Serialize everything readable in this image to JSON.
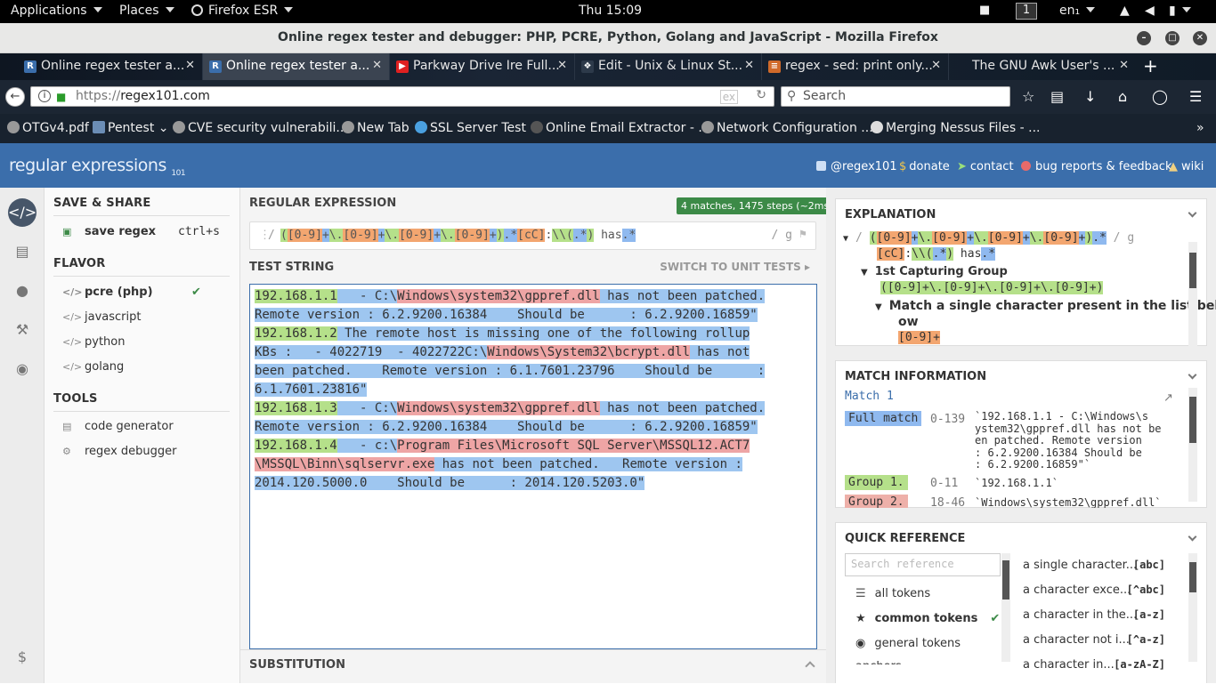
{
  "topbar": {
    "applications": "Applications",
    "places": "Places",
    "firefox": "Firefox ESR",
    "clock": "Thu 15:09",
    "workspace": "1",
    "lang": "en₁"
  },
  "window": {
    "title": "Online regex tester and debugger: PHP, PCRE, Python, Golang and JavaScript - Mozilla Firefox"
  },
  "tabs": [
    {
      "label": "Online regex tester a...",
      "icon": "R",
      "color": "#3b6eab"
    },
    {
      "label": "Online regex tester a...",
      "icon": "R",
      "color": "#3b6eab"
    },
    {
      "label": "Parkway Drive Ire Full...",
      "icon": "▶",
      "color": "#e02020"
    },
    {
      "label": "Edit - Unix & Linux St...",
      "icon": "❖",
      "color": "#2d3a4a"
    },
    {
      "label": "regex - sed: print only...",
      "icon": "≡",
      "color": "#d06a2a"
    },
    {
      "label": "The GNU Awk User's ...",
      "icon": "",
      "color": "#0e1621"
    }
  ],
  "nav": {
    "url_prefix": "https://",
    "url_host": "regex101.com",
    "search_placeholder": "Search"
  },
  "bookmarks": [
    "OTGv4.pdf",
    "Pentest",
    "CVE security vulnerabili...",
    "New Tab",
    "SSL Server Test",
    "Online Email Extractor - ...",
    "Network Configuration ...",
    "Merging Nessus Files - ..."
  ],
  "header": {
    "logo": "regular expressions",
    "logo_sub": "101",
    "links": [
      "@regex101",
      "donate",
      "contact",
      "bug reports & feedback",
      "wiki"
    ]
  },
  "left": {
    "save_share": "SAVE & SHARE",
    "save_regex": "save regex",
    "save_shortcut": "ctrl+s",
    "flavor": "FLAVOR",
    "flavors": [
      "pcre (php)",
      "javascript",
      "python",
      "golang"
    ],
    "tools": "TOOLS",
    "tool_items": [
      "code generator",
      "regex debugger"
    ]
  },
  "regex": {
    "section": "REGULAR EXPRESSION",
    "badge": "4 matches, 1475 steps (~2ms)",
    "delim": "/",
    "flags": "/ g",
    "parts": [
      {
        "t": "(",
        "c": "g1"
      },
      {
        "t": "[0-9]",
        "c": "o"
      },
      {
        "t": "+",
        "c": "b"
      },
      {
        "t": "\\.",
        "c": "g1"
      },
      {
        "t": "[0-9]",
        "c": "o"
      },
      {
        "t": "+",
        "c": "b"
      },
      {
        "t": "\\.",
        "c": "g1"
      },
      {
        "t": "[0-9]",
        "c": "o"
      },
      {
        "t": "+",
        "c": "b"
      },
      {
        "t": "\\.",
        "c": "g1"
      },
      {
        "t": "[0-9]",
        "c": "o"
      },
      {
        "t": "+",
        "c": "b"
      },
      {
        "t": ")",
        "c": "g1"
      },
      {
        "t": ".*",
        "c": "b"
      },
      {
        "t": "[cC]",
        "c": "o"
      },
      {
        "t": ":",
        "c": ""
      },
      {
        "t": "\\\\",
        "c": "g1"
      },
      {
        "t": "(",
        "c": "g1"
      },
      {
        "t": ".*",
        "c": "b"
      },
      {
        "t": ")",
        "c": "g1"
      },
      {
        "t": " has",
        "c": ""
      },
      {
        "t": ".*",
        "c": "b"
      }
    ]
  },
  "test": {
    "section": "TEST STRING",
    "switch": "SWITCH TO UNIT TESTS",
    "lines": [
      [
        {
          "t": "192.168.1.1",
          "c": "mt"
        },
        {
          "t": "   - C:\\",
          "c": "hl"
        },
        {
          "t": "Windows\\system32\\gppref.dll",
          "c": "pk"
        },
        {
          "t": " has not been patched.",
          "c": "hl"
        }
      ],
      [
        {
          "t": "Remote version : 6.2.9200.16384    Should be      : 6.2.9200.16859\"",
          "c": "hl"
        }
      ],
      [
        {
          "t": "192.168.1.2",
          "c": "mt"
        },
        {
          "t": " The remote host is missing one of the following rollup",
          "c": "hl"
        }
      ],
      [
        {
          "t": "KBs :   - 4022719  - 4022722C:\\",
          "c": "hl"
        },
        {
          "t": "Windows\\System32\\bcrypt.dll",
          "c": "pk"
        },
        {
          "t": " has not",
          "c": "hl"
        }
      ],
      [
        {
          "t": "been patched.    Remote version : 6.1.7601.23796    Should be      :",
          "c": "hl"
        }
      ],
      [
        {
          "t": "6.1.7601.23816\"",
          "c": "hl"
        }
      ],
      [
        {
          "t": "192.168.1.3",
          "c": "mt"
        },
        {
          "t": "   - C:\\",
          "c": "hl"
        },
        {
          "t": "Windows\\system32\\gppref.dll",
          "c": "pk"
        },
        {
          "t": " has not been patched.",
          "c": "hl"
        }
      ],
      [
        {
          "t": "Remote version : 6.2.9200.16384    Should be      : 6.2.9200.16859\"",
          "c": "hl"
        }
      ],
      [
        {
          "t": "192.168.1.4",
          "c": "mt"
        },
        {
          "t": "   - c:\\",
          "c": "hl"
        },
        {
          "t": "Program Files\\Microsoft SQL Server\\MSSQL12.ACT7",
          "c": "pk"
        }
      ],
      [
        {
          "t": "\\MSSQL\\Binn\\sqlservr.exe",
          "c": "pk"
        },
        {
          "t": " has not been patched.   Remote version :",
          "c": "hl"
        }
      ],
      [
        {
          "t": "2014.120.5000.0    Should be      : 2014.120.5203.0\"",
          "c": "hl"
        }
      ]
    ]
  },
  "substitution": "SUBSTITUTION",
  "explanation": {
    "title": "EXPLANATION",
    "row1_tail": " / g",
    "row2_b": "[cC]",
    "row2_c": ":",
    "row2_d": "\\\\(",
    "row2_e": ".*",
    "row2_f": ")",
    "row2_g": " has",
    "row2_h": ".*",
    "group1": "1st Capturing Group",
    "group1_expr": "([0-9]+\\.[0-9]+\\.[0-9]+\\.[0-9]+)",
    "match_single": "Match a single character present in the list bel",
    "match_single2": "ow",
    "range": "[0-9]+"
  },
  "match_info": {
    "title": "MATCH INFORMATION",
    "match_label": "Match 1",
    "full_label": "Full match",
    "full_range": "0-139",
    "full_value": [
      "`192.168.1.1   - C:\\Windows\\s",
      "ystem32\\gppref.dll has not be",
      "en patched.    Remote version",
      ": 6.2.9200.16384    Should be",
      ": 6.2.9200.16859\"`"
    ],
    "group1_label": "Group 1.",
    "group1_range": "0-11",
    "group1_value": "`192.168.1.1`",
    "group2_label": "Group 2.",
    "group2_range": "18-46",
    "group2_value": "`Windows\\system32\\gppref.dll`"
  },
  "quickref": {
    "title": "QUICK REFERENCE",
    "search_placeholder": "Search reference",
    "cats": [
      "all tokens",
      "common tokens",
      "general tokens",
      "anchors"
    ],
    "items": [
      {
        "d": "a single character...",
        "c": "[abc]"
      },
      {
        "d": "a character exce...",
        "c": "[^abc]"
      },
      {
        "d": "a character in the...",
        "c": "[a-z]"
      },
      {
        "d": "a character not i...",
        "c": "[^a-z]"
      },
      {
        "d": "a character in...",
        "c": "[a-zA-Z]"
      }
    ]
  },
  "colors": {
    "header": "#3b6eab",
    "group": "#b5e08a",
    "quantifier": "#8fb9ef",
    "class": "#f3a670",
    "path": "#eea5a5"
  }
}
